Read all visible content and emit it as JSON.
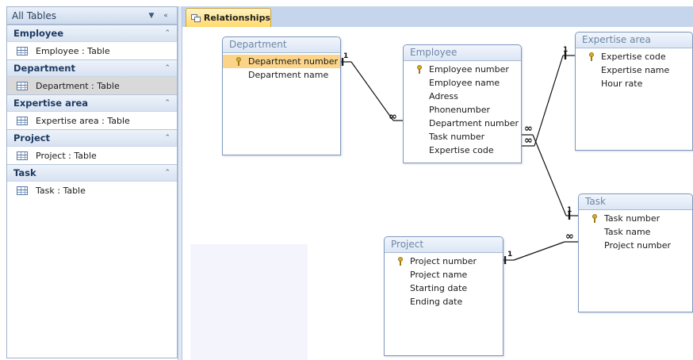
{
  "nav": {
    "title": "All Tables",
    "dropdown_icon": "chevron-down-icon",
    "collapse_icon": "double-chevron-left-icon",
    "groups": [
      {
        "title": "Employee",
        "item": "Employee : Table"
      },
      {
        "title": "Department",
        "item": "Department : Table"
      },
      {
        "title": "Expertise area",
        "item": "Expertise area : Table"
      },
      {
        "title": "Project",
        "item": "Project : Table"
      },
      {
        "title": "Task",
        "item": "Task : Table"
      }
    ]
  },
  "tab": {
    "label": "Relationships"
  },
  "tables": {
    "department": {
      "title": "Department",
      "fields": [
        "Department number",
        "Department name"
      ]
    },
    "employee": {
      "title": "Employee",
      "fields": [
        "Employee number",
        "Employee name",
        "Adress",
        "Phonenumber",
        "Department number",
        "Task number",
        "Expertise code"
      ]
    },
    "expertise": {
      "title": "Expertise area",
      "fields": [
        "Expertise code",
        "Expertise name",
        "Hour rate"
      ]
    },
    "task": {
      "title": "Task",
      "fields": [
        "Task number",
        "Task name",
        "Project number"
      ]
    },
    "project": {
      "title": "Project",
      "fields": [
        "Project number",
        "Project name",
        "Starting date",
        "Ending date"
      ]
    }
  },
  "relationships": {
    "one": "1",
    "many": "∞"
  },
  "colors": {
    "accent_tab": "#ffd96b",
    "selected_field": "#fbd48a",
    "nav_selected": "#d9d9d9"
  }
}
